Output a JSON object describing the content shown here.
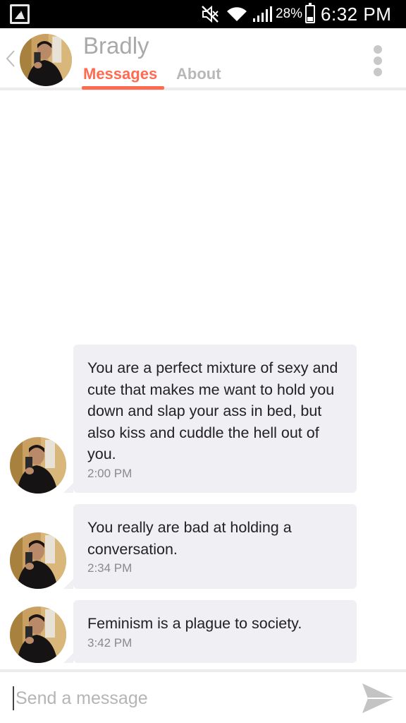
{
  "status_bar": {
    "battery_percent": "28%",
    "battery_level": 0.28,
    "time": "6:32 PM",
    "icons": [
      "gallery-icon",
      "mute-icon",
      "wifi-icon",
      "signal-icon",
      "battery-icon"
    ]
  },
  "header": {
    "name": "Bradly",
    "tabs": [
      {
        "label": "Messages",
        "active": true
      },
      {
        "label": "About",
        "active": false
      }
    ],
    "accent_color": "#ff6b51"
  },
  "messages": [
    {
      "text": "You are a perfect mixture of sexy and cute that makes me want to hold you down and slap your ass in bed, but also kiss and cuddle the hell out of you.",
      "time": "2:00 PM"
    },
    {
      "text": "You really are bad at holding a conversation.",
      "time": "2:34 PM"
    },
    {
      "text": "Feminism is a plague to society.",
      "time": "3:42 PM"
    }
  ],
  "composer": {
    "placeholder": "Send a message"
  }
}
